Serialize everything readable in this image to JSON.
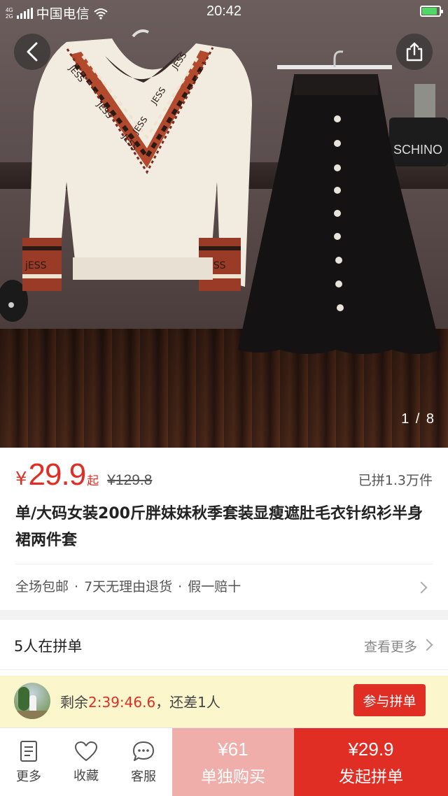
{
  "status_bar": {
    "network_top": "4G",
    "network_bottom": "2G",
    "carrier": "中国电信",
    "time": "20:42",
    "battery_level": 0.9,
    "battery_color": "#4cd964"
  },
  "gallery": {
    "counter": "1 / 8",
    "back_icon": "chevron-left-icon",
    "share_icon": "share-icon",
    "garment_texts": [
      "JESS",
      "JESS",
      "JESS",
      "JESS",
      "JESS",
      "JESS",
      "jESS",
      "jESS"
    ],
    "bag_text": "SCHINO"
  },
  "product": {
    "currency": "¥",
    "price": "29.9",
    "price_suffix": "起",
    "original_price": "¥129.8",
    "sold": "已拼1.3万件",
    "title": "单/大码女装200斤胖妹妹秋季套装显瘦遮肚毛衣针织衫半身裙两件套",
    "services": [
      "全场包邮",
      "7天无理由退货",
      "假一赔十"
    ],
    "service_separator": "·"
  },
  "group": {
    "title": "5人在拼单",
    "more": "查看更多",
    "row": {
      "prefix": "剩余",
      "countdown": "2:39:46.6",
      "suffix": "，还差1人",
      "join_label": "参与拼单"
    }
  },
  "bottom_bar": {
    "more_label": "更多",
    "fav_label": "收藏",
    "service_label": "客服",
    "single_price": "¥61",
    "single_label": "单独购买",
    "group_price": "¥29.9",
    "group_label": "发起拼单"
  },
  "colors": {
    "accent": "#e02e24",
    "accent_light": "#f0aeaa",
    "group_row_bg": "#fbf6cc"
  }
}
